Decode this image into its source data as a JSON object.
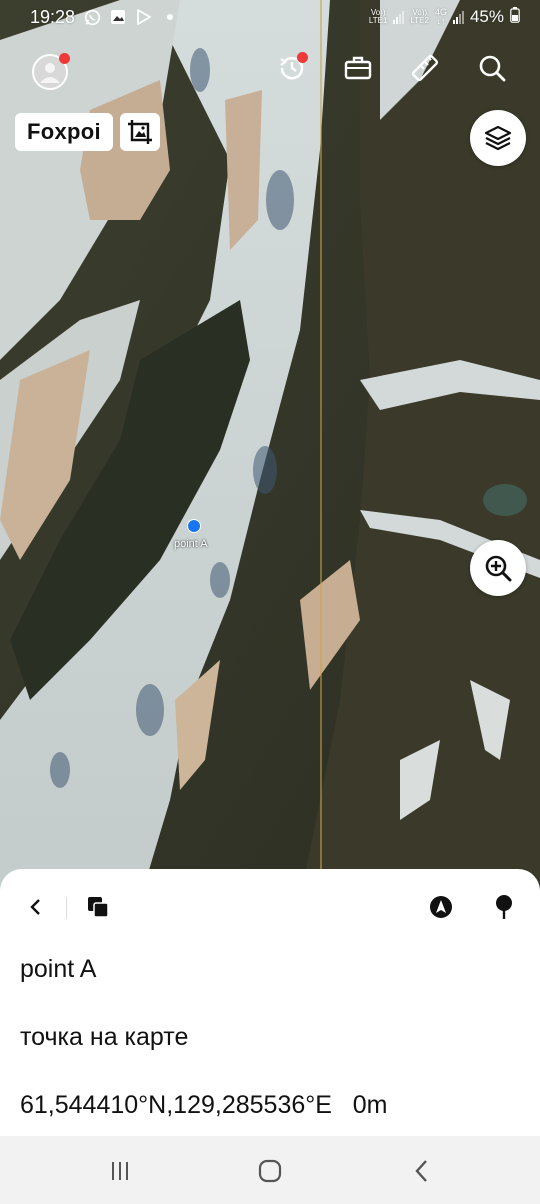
{
  "status_bar": {
    "time": "19:28",
    "left_icons": [
      "whatsapp-icon",
      "gallery-icon",
      "play-store-icon",
      "dot-icon"
    ],
    "sim1_label_top": "Vo))",
    "sim1_label_bottom": "LTE1",
    "sim2_label_top": "Vo))",
    "sim2_label_bottom": "LTE2",
    "network_type": "4G",
    "battery_percent": "45%"
  },
  "top_bar": {
    "avatar_has_notification": true,
    "tools": [
      "history-icon",
      "briefcase-icon",
      "ruler-icon",
      "search-icon"
    ],
    "history_has_notification": true
  },
  "brand": {
    "logo_text": "Foxpoi"
  },
  "map": {
    "marker_label": "point A",
    "marker_color": "#1976f0",
    "guide_line_color": "#c9a44a"
  },
  "sheet": {
    "title": "point A",
    "description": "точка на карте",
    "coordinates": "61,544410°N,129,285536°E   0m"
  },
  "colors": {
    "notification": "#f03a3a",
    "sheet_bg": "#ffffff",
    "navbar_bg": "#f2f2f2"
  }
}
